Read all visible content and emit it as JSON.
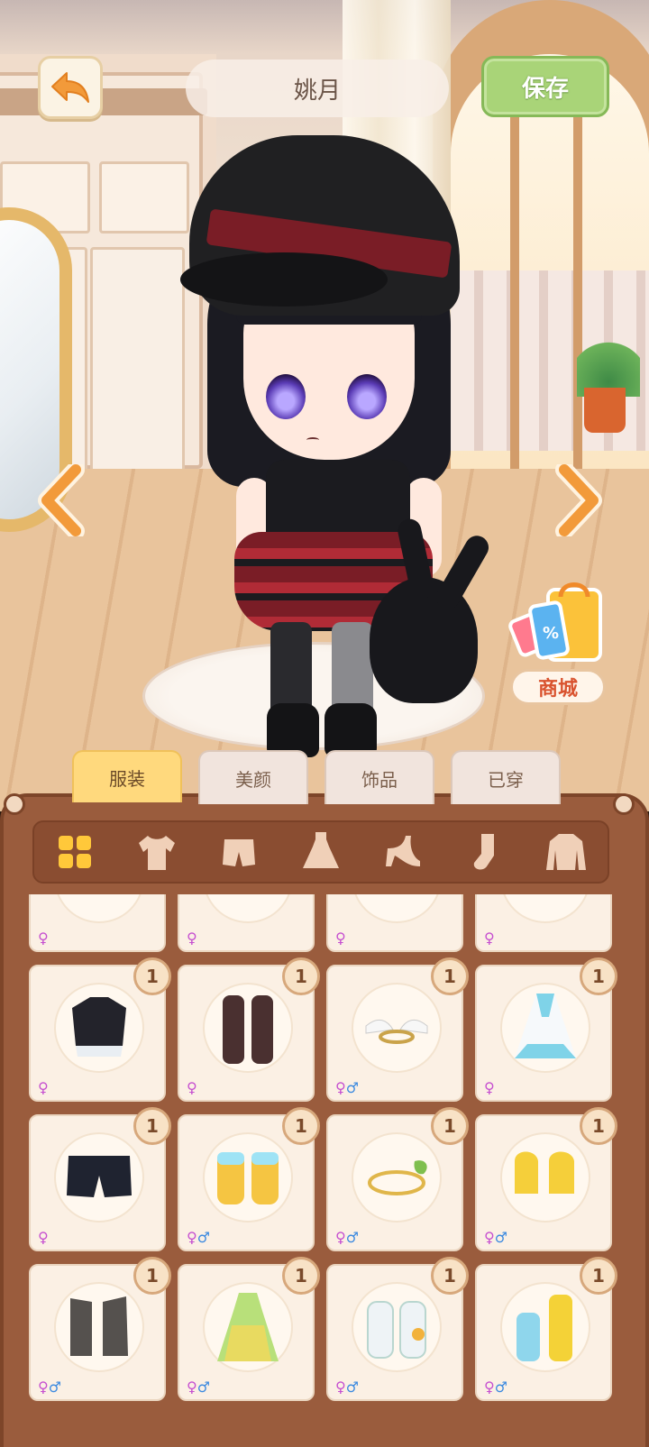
{
  "header": {
    "back_icon": "back-arrow-icon",
    "character_name": "姚月",
    "save_label": "保存"
  },
  "scene": {
    "prev_icon": "chevron-left-icon",
    "next_icon": "chevron-right-icon",
    "shop_label": "商城",
    "shop_icon": "shopping-bag-icon"
  },
  "tabs": [
    {
      "label": "服装",
      "active": true
    },
    {
      "label": "美颜",
      "active": false
    },
    {
      "label": "饰品",
      "active": false
    },
    {
      "label": "已穿",
      "active": false
    }
  ],
  "categories": [
    {
      "icon": "all-grid-icon",
      "active": true
    },
    {
      "icon": "top-shirt-icon",
      "active": false
    },
    {
      "icon": "shorts-icon",
      "active": false
    },
    {
      "icon": "dress-icon",
      "active": false
    },
    {
      "icon": "high-heel-icon",
      "active": false
    },
    {
      "icon": "sock-icon",
      "active": false
    },
    {
      "icon": "jacket-icon",
      "active": false
    }
  ],
  "items_partial": [
    {
      "gender": "♀",
      "icon": "stockings-icon"
    },
    {
      "gender": "♀",
      "icon": "black-shoes-icon"
    },
    {
      "gender": "♀",
      "icon": "brown-shoes-icon"
    },
    {
      "gender": "♀",
      "icon": "blue-socks-icon"
    }
  ],
  "items": [
    {
      "count": "1",
      "gender_f": "♀",
      "gender_m": "",
      "icon": "crop-top-icon",
      "color": "#23232b"
    },
    {
      "count": "1",
      "gender_f": "♀",
      "gender_m": "",
      "icon": "thigh-socks-icon",
      "color": "#4a3030"
    },
    {
      "count": "1",
      "gender_f": "♀",
      "gender_m": "♂",
      "icon": "winged-bracelet-icon",
      "color": "#caa34a"
    },
    {
      "count": "1",
      "gender_f": "♀",
      "gender_m": "",
      "icon": "blue-robe-icon",
      "color": "#7fd3e8"
    },
    {
      "count": "1",
      "gender_f": "♀",
      "gender_m": "",
      "icon": "black-shorts-icon",
      "color": "#1f2330"
    },
    {
      "count": "1",
      "gender_f": "♀",
      "gender_m": "♂",
      "icon": "yellow-boots-icon",
      "color": "#f5c542"
    },
    {
      "count": "1",
      "gender_f": "♀",
      "gender_m": "♂",
      "icon": "leaf-headband-icon",
      "color": "#e0b64a"
    },
    {
      "count": "1",
      "gender_f": "♀",
      "gender_m": "♂",
      "icon": "yellow-gloves-icon",
      "color": "#f5cf3a"
    },
    {
      "count": "1",
      "gender_f": "♀",
      "gender_m": "♂",
      "icon": "gray-boots-icon",
      "color": "#55514e"
    },
    {
      "count": "1",
      "gender_f": "♀",
      "gender_m": "♂",
      "icon": "green-dress-icon",
      "color": "#b8e07a"
    },
    {
      "count": "1",
      "gender_f": "♀",
      "gender_m": "♂",
      "icon": "white-boots-icon",
      "color": "#eef3f6"
    },
    {
      "count": "1",
      "gender_f": "♀",
      "gender_m": "♂",
      "icon": "blue-yellow-socks-icon",
      "color": "#f4d237"
    }
  ],
  "colors": {
    "save_green": "#a9d478",
    "active_tab": "#ffd97d",
    "panel_brown": "#9a5c3d",
    "arrow_orange": "#f29a3a"
  }
}
